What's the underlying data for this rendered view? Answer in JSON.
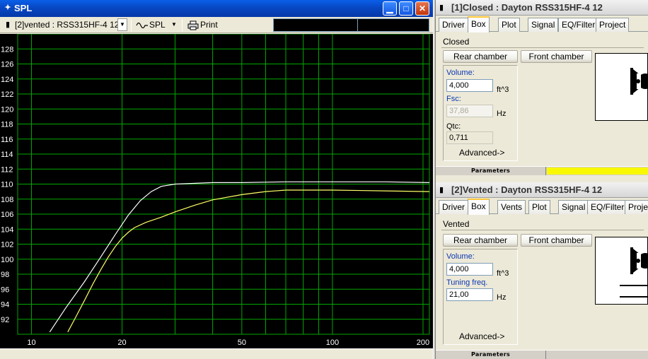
{
  "spl_window": {
    "title": "SPL",
    "buttons": {
      "minimize": "▁",
      "maximize": "□",
      "close": "✕"
    },
    "toolbar": {
      "driver_select": "[2]vented : RSS315HF-4 12''",
      "mode_label": "SPL",
      "print_label": "Print"
    }
  },
  "chart_data": {
    "type": "line",
    "xlabel": "",
    "ylabel": "",
    "x_scale": "log",
    "xlim": [
      9,
      210
    ],
    "ylim": [
      90,
      130
    ],
    "x_ticks": [
      10,
      20,
      50,
      100,
      200
    ],
    "x_tick_labels": [
      "10",
      "20",
      "50",
      "100",
      "200"
    ],
    "y_ticks": [
      92,
      94,
      96,
      98,
      100,
      102,
      104,
      106,
      108,
      110,
      112,
      114,
      116,
      118,
      120,
      122,
      124,
      126,
      128
    ],
    "grid": true,
    "background": "#000000",
    "grid_color": "#00a800",
    "series": [
      {
        "color": "#ffffff",
        "x": [
          11.5,
          13,
          15,
          17,
          19,
          21,
          23,
          25,
          27,
          30,
          35,
          40,
          50,
          70,
          100,
          150,
          210
        ],
        "y": [
          90.3,
          93.5,
          97.0,
          100.3,
          103.3,
          105.9,
          107.8,
          109.0,
          109.7,
          110.0,
          110.1,
          110.2,
          110.2,
          110.3,
          110.3,
          110.3,
          110.2
        ]
      },
      {
        "color": "#ffff66",
        "x": [
          13.2,
          14,
          15,
          16,
          17,
          18,
          19,
          20,
          21,
          22,
          24,
          27,
          30,
          35,
          40,
          50,
          60,
          70,
          100,
          150,
          210
        ],
        "y": [
          90.3,
          92.2,
          94.5,
          96.7,
          98.6,
          100.3,
          101.7,
          102.8,
          103.6,
          104.2,
          104.9,
          105.6,
          106.3,
          107.2,
          107.9,
          108.6,
          109.0,
          109.2,
          109.2,
          109.1,
          109.0
        ]
      }
    ]
  },
  "panel_closed": {
    "title": "[1]Closed : Dayton RSS315HF-4 12",
    "tabs": [
      "Driver",
      "Box",
      "Plot",
      "Signal",
      "EQ/Filter",
      "Project"
    ],
    "active_tab": "Box",
    "type_label": "Closed",
    "rear_chamber_btn": "Rear chamber",
    "front_chamber_btn": "Front chamber",
    "volume_label": "Volume:",
    "volume_value": "4,000",
    "volume_unit": "ft^3",
    "fsc_label": "Fsc:",
    "fsc_value": "37,86",
    "fsc_unit": "Hz",
    "qtc_label": "Qtc:",
    "qtc_value": "0,711",
    "advanced_btn": "Advanced->",
    "params_label": "Parameters"
  },
  "panel_vented": {
    "title": "[2]Vented : Dayton RSS315HF-4 12",
    "tabs": [
      "Driver",
      "Box",
      "Vents",
      "Plot",
      "Signal",
      "EQ/Filter",
      "Projec"
    ],
    "active_tab": "Box",
    "type_label": "Vented",
    "rear_chamber_btn": "Rear chamber",
    "front_chamber_btn": "Front chamber",
    "volume_label": "Volume:",
    "volume_value": "4,000",
    "volume_unit": "ft^3",
    "tuning_label": "Tuning freq.",
    "tuning_value": "21,00",
    "tuning_unit": "Hz",
    "advanced_btn": "Advanced->",
    "params_label": "Parameters"
  }
}
